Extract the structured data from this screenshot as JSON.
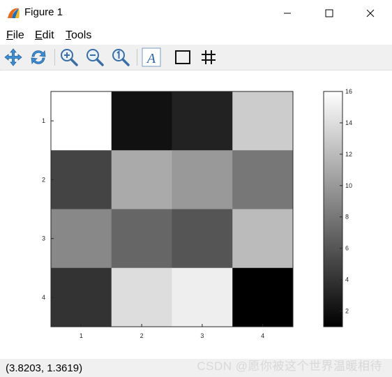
{
  "window": {
    "title": "Figure 1"
  },
  "menu": {
    "items": [
      {
        "name": "menu-file",
        "underline": "F",
        "rest": "ile"
      },
      {
        "name": "menu-edit",
        "underline": "E",
        "rest": "dit"
      },
      {
        "name": "menu-tools",
        "underline": "T",
        "rest": "ools"
      }
    ]
  },
  "toolbar": {
    "icons": [
      "pan-icon",
      "rotate-icon",
      "zoom-in-icon",
      "zoom-out-icon",
      "zoom-reset-icon",
      "text-annotation-icon",
      "axes-box-icon",
      "grid-icon"
    ]
  },
  "status": {
    "coords": "(3.8203, 1.3619)",
    "watermark": "CSDN @愿你被这个世界温暖相待"
  },
  "chart_data": {
    "type": "heatmap",
    "x_ticks": [
      "1",
      "2",
      "3",
      "4"
    ],
    "y_ticks": [
      "1",
      "2",
      "3",
      "4"
    ],
    "values": [
      [
        16,
        2,
        3,
        13
      ],
      [
        5,
        11,
        10,
        8
      ],
      [
        9,
        7,
        6,
        12
      ],
      [
        4,
        14,
        15,
        1
      ]
    ],
    "colormap": "gray",
    "clim": [
      1,
      16
    ],
    "colorbar": {
      "ticks": [
        "2",
        "4",
        "6",
        "8",
        "10",
        "12",
        "14",
        "16"
      ],
      "tick_values": [
        2,
        4,
        6,
        8,
        10,
        12,
        14,
        16
      ]
    }
  }
}
